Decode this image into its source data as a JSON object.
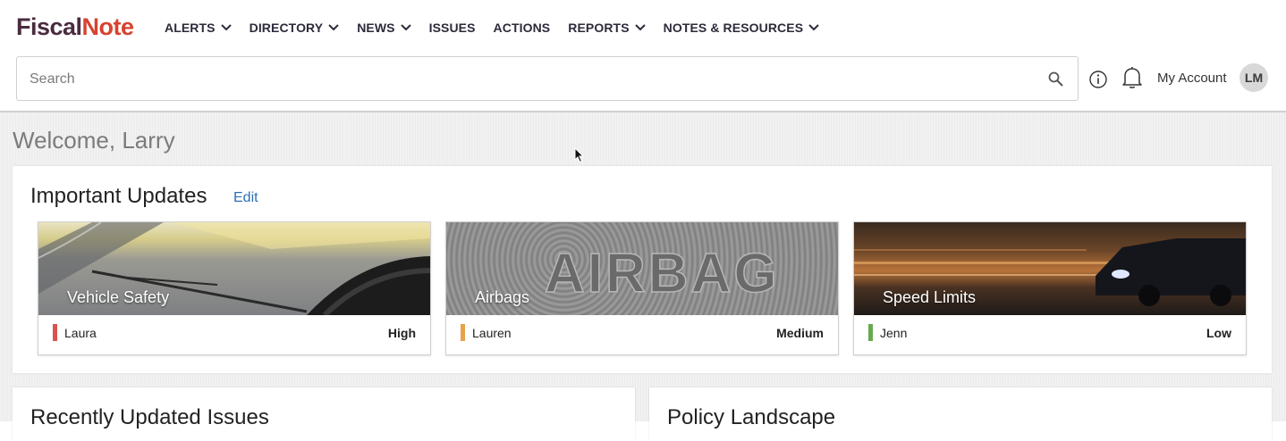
{
  "brand": {
    "part1": "Fiscal",
    "part2": "Note"
  },
  "nav": [
    {
      "label": "ALERTS",
      "has_dropdown": true
    },
    {
      "label": "DIRECTORY",
      "has_dropdown": true
    },
    {
      "label": "NEWS",
      "has_dropdown": true
    },
    {
      "label": "ISSUES",
      "has_dropdown": false
    },
    {
      "label": "ACTIONS",
      "has_dropdown": false
    },
    {
      "label": "REPORTS",
      "has_dropdown": true
    },
    {
      "label": "NOTES & RESOURCES",
      "has_dropdown": true
    }
  ],
  "search": {
    "placeholder": "Search",
    "value": ""
  },
  "account": {
    "label": "My Account",
    "initials": "LM"
  },
  "welcome": "Welcome, Larry",
  "important_updates": {
    "title": "Important Updates",
    "edit_label": "Edit",
    "cards": [
      {
        "title": "Vehicle Safety",
        "owner": "Laura",
        "priority": "High",
        "priority_color": "#d9534f"
      },
      {
        "title": "Airbags",
        "owner": "Lauren",
        "priority": "Medium",
        "priority_color": "#e8a34a"
      },
      {
        "title": "Speed Limits",
        "owner": "Jenn",
        "priority": "Low",
        "priority_color": "#6aa84f"
      }
    ]
  },
  "panels": {
    "recent_issues": "Recently Updated Issues",
    "policy_landscape": "Policy Landscape"
  },
  "colors": {
    "brand_dark": "#4a2b3f",
    "brand_red": "#d7432f",
    "link": "#2f6fb5"
  }
}
